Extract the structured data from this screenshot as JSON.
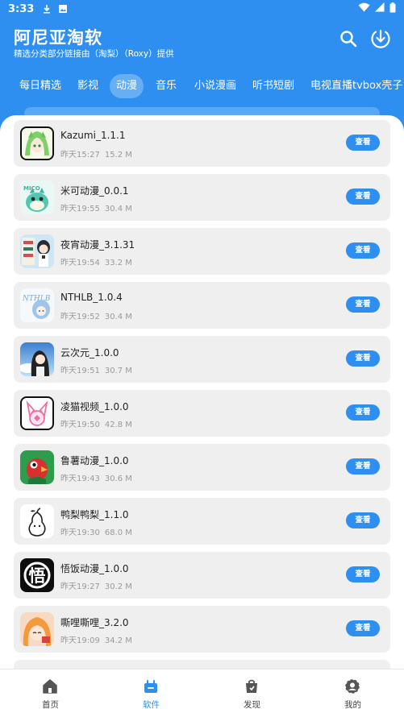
{
  "status_bar": {
    "time": "3:33"
  },
  "header": {
    "title": "阿尼亚淘软",
    "subtitle": "精选分类部分链接由（淘梨）（Roxy）提供"
  },
  "tabs": [
    {
      "label": "每日精选"
    },
    {
      "label": "影视"
    },
    {
      "label": "动漫",
      "active": true
    },
    {
      "label": "音乐"
    },
    {
      "label": "小说漫画"
    },
    {
      "label": "听书短剧"
    },
    {
      "label": "电视直播tvbox壳子"
    }
  ],
  "apps": [
    {
      "name": "Kazumi_1.1.1",
      "time": "昨天15:27",
      "size": "15.2 M",
      "button": "查看",
      "icon": "kazumi-icon"
    },
    {
      "name": "米可动漫_0.0.1",
      "time": "昨天19:55",
      "size": "30.4 M",
      "button": "查看",
      "icon": "mico-anime-icon"
    },
    {
      "name": "夜宵动漫_3.1.31",
      "time": "昨天19:54",
      "size": "33.2 M",
      "button": "查看",
      "icon": "yexiao-anime-icon"
    },
    {
      "name": "NTHLB_1.0.4",
      "time": "昨天19:52",
      "size": "30.4 M",
      "button": "查看",
      "icon": "nthlb-icon"
    },
    {
      "name": "云次元_1.0.0",
      "time": "昨天19:51",
      "size": "30.7 M",
      "button": "查看",
      "icon": "yunciyuan-icon"
    },
    {
      "name": "凌猫视频_1.0.0",
      "time": "昨天19:50",
      "size": "42.8 M",
      "button": "查看",
      "icon": "lingmao-video-icon"
    },
    {
      "name": "鲁薯动漫_1.0.0",
      "time": "昨天19:43",
      "size": "30.6 M",
      "button": "查看",
      "icon": "lushu-anime-icon"
    },
    {
      "name": "鸭梨鸭梨_1.1.0",
      "time": "昨天19:30",
      "size": "68.0 M",
      "button": "查看",
      "icon": "yali-yali-icon"
    },
    {
      "name": "悟饭动漫_1.0.0",
      "time": "昨天19:27",
      "size": "30.2 M",
      "button": "查看",
      "icon": "wufan-anime-icon"
    },
    {
      "name": "嘶哩嘶哩_3.2.0",
      "time": "昨天19:09",
      "size": "34.2 M",
      "button": "查看",
      "icon": "silisili-icon"
    }
  ],
  "bottom_nav": [
    {
      "label": "首页",
      "icon": "home-icon"
    },
    {
      "label": "软件",
      "icon": "software-icon",
      "active": true
    },
    {
      "label": "发现",
      "icon": "discover-bag-icon"
    },
    {
      "label": "我的",
      "icon": "profile-icon"
    }
  ],
  "colors": {
    "primary": "#2f8ff0",
    "card_bg": "#efefef",
    "meta_text": "#9a9a9a"
  }
}
